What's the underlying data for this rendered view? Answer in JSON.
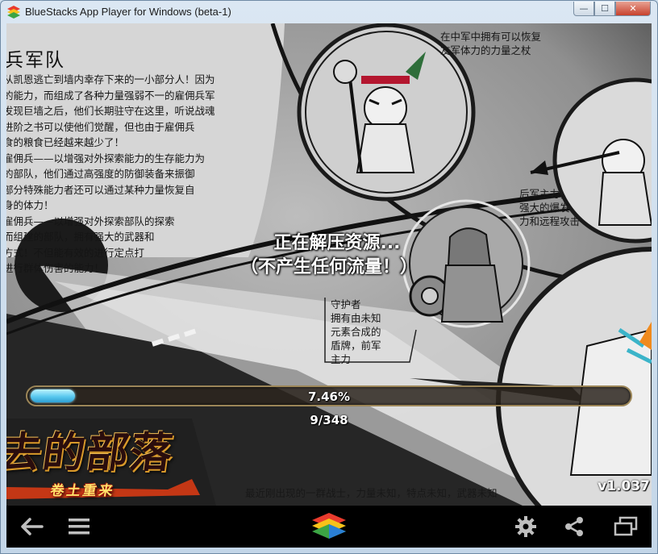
{
  "window": {
    "title": "BlueStacks App Player for Windows (beta-1)",
    "controls": {
      "minimize": "—",
      "maximize": "☐",
      "close": "✕"
    }
  },
  "lore_panel": {
    "heading": "兵军队",
    "lines": [
      "从凯恩逃亡到墙内幸存下来的一小部分人！因为",
      "的能力，而组成了各种力量强弱不一的雇佣兵军",
      "发现巨墙之后，他们长期驻守在这里，听说战魂",
      "进阶之书可以使他们觉醒，但也由于雇佣兵",
      "食的粮食已经越来越少了！",
      "雇佣兵——以增强对外探索能力的生存能力为",
      "的部队，他们通过高强度的防御装备来振御",
      "部分特殊能力者还可以通过某种力量恢复自",
      "身的体力！",
      "雇佣兵——以增强对外探索部队的探索",
      "而组建的部队，拥有强大的武器和",
      "方式！不但能有效的进行定点打",
      "进行群体伤害的能力！"
    ]
  },
  "callouts": {
    "top": [
      "在中军中拥有可以恢复",
      "友军体力的力量之杖"
    ],
    "right": [
      "后军主力，",
      "强大的爆发",
      "力和远程攻击"
    ],
    "guard": [
      "守护者",
      "拥有由未知",
      "元素合成的",
      "盾牌，前军",
      "主力"
    ]
  },
  "loading": {
    "line1": "正在解压资源...",
    "line2": "（不产生任何流量！）",
    "progress_percent_label": "7.46%",
    "progress_fraction": 0.0746,
    "count_label": "9/348"
  },
  "branding": {
    "logo_text": "去的部落",
    "logo_subtitle": "卷土重来",
    "tagline": "最近刚出现的一群战士，力量未知，特点未知，武器未知",
    "version": "v1.037"
  },
  "colors": {
    "progress_fill": "#5ac9ef",
    "nav_background": "#000000",
    "close_button": "#c7412d"
  },
  "navbar": {
    "icons": [
      "back-arrow-icon",
      "menu-icon",
      "bluestacks-home-icon",
      "gear-icon",
      "share-icon",
      "window-resize-icon"
    ]
  }
}
